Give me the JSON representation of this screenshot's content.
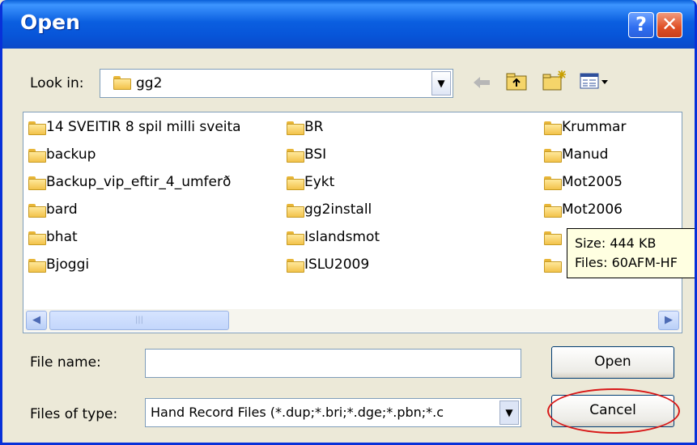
{
  "window": {
    "title": "Open"
  },
  "title_buttons": {
    "help": "?",
    "close": "✕"
  },
  "look_in": {
    "label": "Look in:",
    "value": "gg2"
  },
  "files": [
    {
      "name": "14 SVEITIR 8 spil milli sveita"
    },
    {
      "name": "backup"
    },
    {
      "name": "Backup_vip_eftir_4_umferð"
    },
    {
      "name": "bard"
    },
    {
      "name": "bhat"
    },
    {
      "name": "Bjoggi"
    },
    {
      "name": "BR"
    },
    {
      "name": "BSI"
    },
    {
      "name": "Eykt"
    },
    {
      "name": "gg2install"
    },
    {
      "name": "Islandsmot"
    },
    {
      "name": "ISLU2009"
    },
    {
      "name": "Krummar"
    },
    {
      "name": "Manud"
    },
    {
      "name": "Mot2005"
    },
    {
      "name": "Mot2006"
    }
  ],
  "tooltip": {
    "size": "Size: 444 KB",
    "files": "Files: 60AFM-HF"
  },
  "file_name": {
    "label": "File name:",
    "value": ""
  },
  "file_type": {
    "label": "Files of type:",
    "value": "Hand Record Files (*.dup;*.bri;*.dge;*.pbn;*.c"
  },
  "buttons": {
    "open": "Open",
    "cancel": "Cancel"
  },
  "icons": {
    "back": "back-arrow-icon",
    "up": "up-one-level-icon",
    "new_folder": "create-new-folder-icon",
    "views": "view-menu-icon"
  },
  "accent": {
    "title_bar": "#0b5fe0",
    "highlight": "#d81818"
  }
}
